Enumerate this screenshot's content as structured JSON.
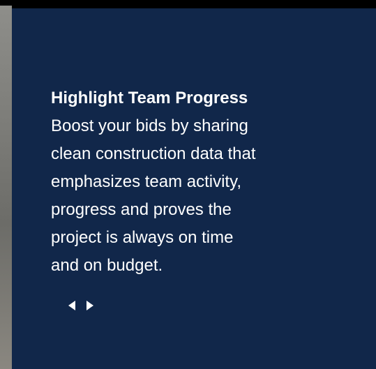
{
  "slide": {
    "headline": "Highlight Team Progress",
    "body": "Boost your bids by sharing\nclean construction data that\nemphasizes team activity,\nprogress and proves the\nproject is always on time\nand on budget."
  },
  "controls": {
    "previous_icon": "triangle-left-icon",
    "next_icon": "triangle-right-icon"
  },
  "colors": {
    "card_background": "#11274a",
    "text": "#ffffff"
  }
}
